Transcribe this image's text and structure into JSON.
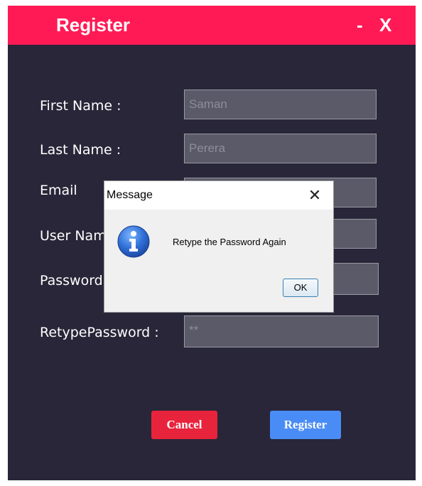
{
  "window": {
    "title": "Register",
    "minimize_label": "-",
    "close_label": "X"
  },
  "form": {
    "first_name": {
      "label": "First Name :",
      "value": "Saman"
    },
    "last_name": {
      "label": "Last Name :",
      "value": "Perera"
    },
    "email": {
      "label": "Email",
      "value": ""
    },
    "user_name": {
      "label": "User Name :",
      "value": ""
    },
    "password": {
      "label": "Password :",
      "value": ""
    },
    "retype_password": {
      "label": "RetypePassword :",
      "value": "**"
    }
  },
  "buttons": {
    "cancel": "Cancel",
    "register": "Register"
  },
  "dialog": {
    "title": "Message",
    "close_label": "✕",
    "message": "Retype the Password Again",
    "ok_label": "OK",
    "icon": "info-icon"
  },
  "colors": {
    "titlebar": "#ff1a55",
    "background": "#282638",
    "cancel": "#e8243d",
    "register": "#4a8cf5"
  }
}
